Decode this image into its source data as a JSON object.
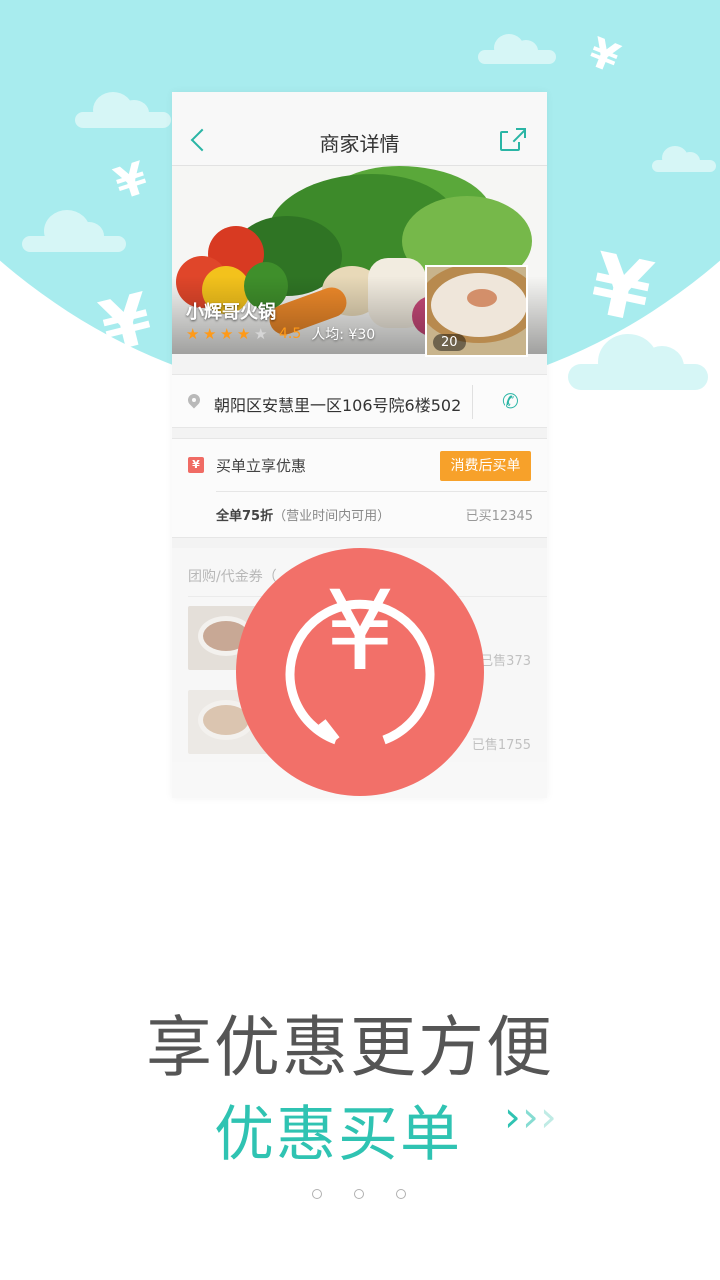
{
  "phone": {
    "nav": {
      "title": "商家详情"
    },
    "shop": {
      "name": "小辉哥火锅",
      "score": "4.5",
      "avg_price": "人均: ¥30",
      "photo_count": "20",
      "stars_filled": 4,
      "stars_total": 5
    },
    "address": {
      "text": "朝阳区安慧里一区106号院6楼502"
    },
    "pay": {
      "icon_glyph": "¥",
      "title": "买单立享优惠",
      "button": "消费后买单",
      "desc_bold": "全单75折",
      "desc_note": "（营业时间内可用）",
      "sold": "已买12345"
    },
    "group": {
      "heading": "团购/代金券（",
      "deals": [
        {
          "sold": "已售373"
        },
        {
          "sold": "已售1755"
        }
      ]
    }
  },
  "badge": {
    "glyph": "¥"
  },
  "headline": "享优惠更方便",
  "subline": "优惠买单",
  "arrows": [
    "›",
    "›",
    "›"
  ],
  "pager": {
    "count": 3,
    "active": 0
  },
  "colors": {
    "accent": "#2ab5a5",
    "sky": "#a8ecee",
    "badge": "#f27069",
    "pay_button": "#f7a12a",
    "star": "#ff9a18"
  }
}
